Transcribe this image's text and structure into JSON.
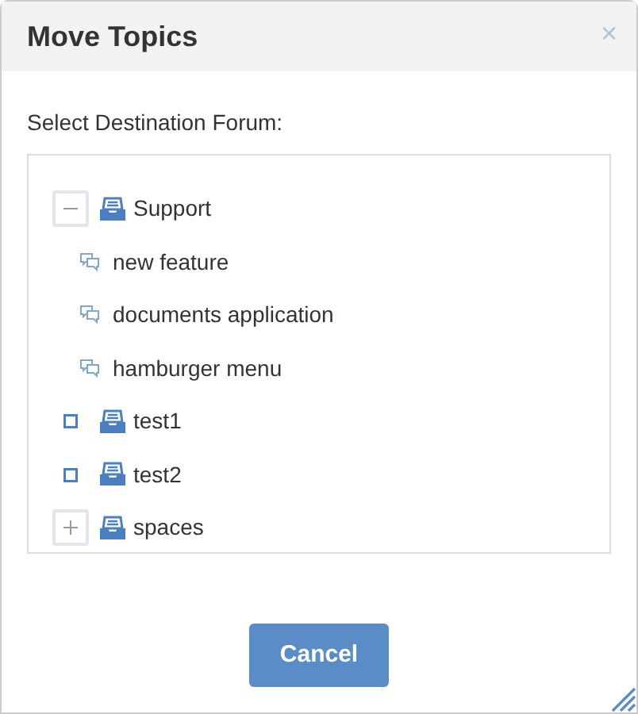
{
  "dialog": {
    "title": "Move Topics",
    "close": "×"
  },
  "label": "Select Destination Forum:",
  "tree": [
    {
      "kind": "category",
      "label": "Support",
      "expanded": true,
      "children": [
        {
          "kind": "topic",
          "label": "new feature"
        },
        {
          "kind": "topic",
          "label": "documents application"
        },
        {
          "kind": "topic",
          "label": "hamburger menu"
        }
      ]
    },
    {
      "kind": "forum",
      "label": "test1"
    },
    {
      "kind": "forum",
      "label": "test2"
    },
    {
      "kind": "category",
      "label": "spaces",
      "expanded": false
    }
  ],
  "buttons": [
    "Cancel"
  ]
}
